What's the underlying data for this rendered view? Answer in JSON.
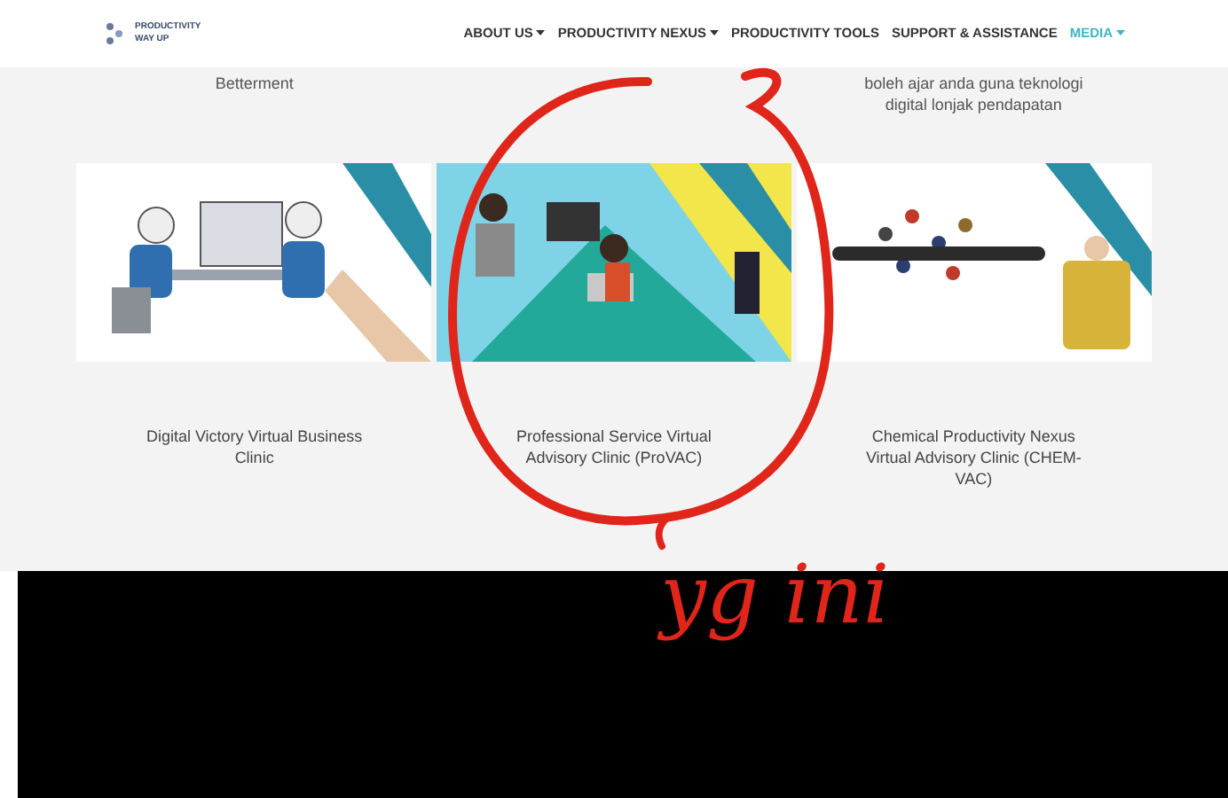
{
  "header": {
    "logo": {
      "line_1": "PRODUCTIVITY",
      "line_2": "WAY UP"
    },
    "nav": [
      {
        "label": "ABOUT US",
        "dropdown": true,
        "selected": false
      },
      {
        "label": "PRODUCTIVITY NEXUS",
        "dropdown": true,
        "selected": false
      },
      {
        "label": "PRODUCTIVITY TOOLS",
        "dropdown": false,
        "selected": false
      },
      {
        "label": "SUPPORT & ASSISTANCE",
        "dropdown": false,
        "selected": false
      },
      {
        "label": "MEDIA",
        "dropdown": true,
        "selected": true
      }
    ]
  },
  "previous_row": [
    {
      "lines": [
        "Betterment"
      ]
    },
    {
      "lines": [
        "boleh ajar anda guna teknologi",
        "digital lonjak pendapatan"
      ]
    }
  ],
  "cards": [
    {
      "title": "Digital Victory Virtual Business Clinic"
    },
    {
      "title": "Professional Service Virtual Advisory Clinic (ProVAC)"
    },
    {
      "title": "Chemical Productivity Nexus Virtual Advisory Clinic (CHEM-VAC)"
    }
  ],
  "annotation": {
    "handwriting": "yg ini"
  }
}
